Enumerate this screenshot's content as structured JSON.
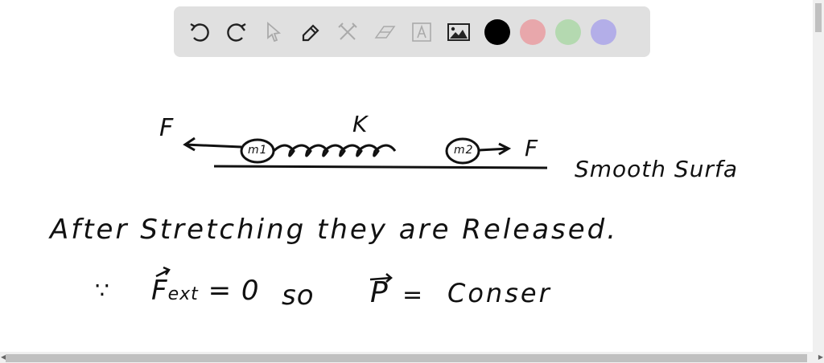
{
  "toolbar": {
    "tools": [
      "undo-icon",
      "redo-icon",
      "select-icon",
      "pen-icon",
      "tools-icon",
      "eraser-icon",
      "text-icon",
      "image-icon"
    ],
    "colors": [
      "#000000",
      "#e8a7ab",
      "#b4d9b0",
      "#b3aee8"
    ]
  },
  "canvas": {
    "force_left": "F",
    "spring_constant": "K",
    "mass1": "m1",
    "mass2": "m2",
    "force_right": "F",
    "surface_label": "Smooth Surfa",
    "line1": "After Stretching they are Released.",
    "because": "∵",
    "fext": "F",
    "fext_sub": "ext",
    "fext_eq": "= 0",
    "so": "so",
    "p": "P",
    "p_eq": "=",
    "conserved": "Conser"
  }
}
